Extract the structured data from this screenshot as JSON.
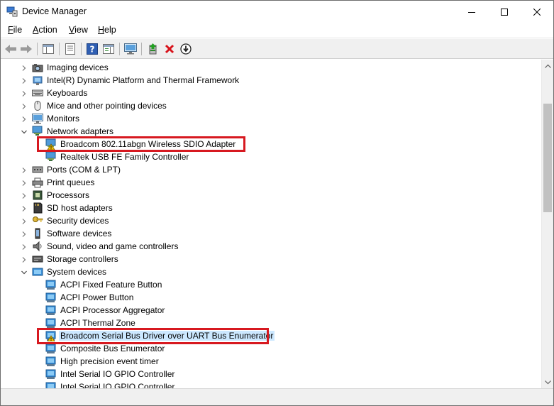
{
  "window": {
    "title": "Device Manager",
    "icon": "device-manager-icon"
  },
  "menu": {
    "file": "File",
    "action": "Action",
    "view": "View",
    "help": "Help"
  },
  "toolbar": {
    "buttons": [
      "back-icon",
      "forward-icon",
      "show-hide-console-tree-icon",
      "properties-icon",
      "help-icon",
      "action-pane-icon",
      "monitor-icon",
      "update-driver-icon",
      "uninstall-icon",
      "download-icon"
    ]
  },
  "tree": {
    "items": [
      {
        "label": "Imaging devices",
        "level": 0,
        "expanded": false,
        "icon": "camera-icon"
      },
      {
        "label": "Intel(R) Dynamic Platform and Thermal Framework",
        "level": 0,
        "expanded": false,
        "icon": "computer-chip-icon"
      },
      {
        "label": "Keyboards",
        "level": 0,
        "expanded": false,
        "icon": "keyboard-icon"
      },
      {
        "label": "Mice and other pointing devices",
        "level": 0,
        "expanded": false,
        "icon": "mouse-icon"
      },
      {
        "label": "Monitors",
        "level": 0,
        "expanded": false,
        "icon": "monitor-icon"
      },
      {
        "label": "Network adapters",
        "level": 0,
        "expanded": true,
        "icon": "network-adapter-icon"
      },
      {
        "label": "Broadcom 802.11abgn Wireless SDIO Adapter",
        "level": 1,
        "warning": true,
        "icon": "network-adapter-warning-icon"
      },
      {
        "label": "Realtek USB FE Family Controller",
        "level": 1,
        "icon": "network-adapter-icon"
      },
      {
        "label": "Ports (COM & LPT)",
        "level": 0,
        "expanded": false,
        "icon": "port-icon"
      },
      {
        "label": "Print queues",
        "level": 0,
        "expanded": false,
        "icon": "printer-icon"
      },
      {
        "label": "Processors",
        "level": 0,
        "expanded": false,
        "icon": "processor-icon"
      },
      {
        "label": "SD host adapters",
        "level": 0,
        "expanded": false,
        "icon": "sd-card-icon"
      },
      {
        "label": "Security devices",
        "level": 0,
        "expanded": false,
        "icon": "key-icon"
      },
      {
        "label": "Software devices",
        "level": 0,
        "expanded": false,
        "icon": "software-device-icon"
      },
      {
        "label": "Sound, video and game controllers",
        "level": 0,
        "expanded": false,
        "icon": "speaker-icon"
      },
      {
        "label": "Storage controllers",
        "level": 0,
        "expanded": false,
        "icon": "storage-controller-icon"
      },
      {
        "label": "System devices",
        "level": 0,
        "expanded": true,
        "icon": "system-folder-icon"
      },
      {
        "label": "ACPI Fixed Feature Button",
        "level": 1,
        "icon": "system-device-icon"
      },
      {
        "label": "ACPI Power Button",
        "level": 1,
        "icon": "system-device-icon"
      },
      {
        "label": "ACPI Processor Aggregator",
        "level": 1,
        "icon": "system-device-icon"
      },
      {
        "label": "ACPI Thermal Zone",
        "level": 1,
        "icon": "system-device-icon"
      },
      {
        "label": "Broadcom Serial Bus Driver over UART Bus Enumerator",
        "level": 1,
        "warning": true,
        "selected": true,
        "icon": "system-device-warning-icon"
      },
      {
        "label": "Composite Bus Enumerator",
        "level": 1,
        "icon": "system-device-icon"
      },
      {
        "label": "High precision event timer",
        "level": 1,
        "icon": "system-device-icon"
      },
      {
        "label": "Intel Serial IO GPIO Controller",
        "level": 1,
        "icon": "system-device-icon"
      },
      {
        "label": "Intel Serial IO GPIO Controller",
        "level": 1,
        "icon": "system-device-icon"
      }
    ]
  },
  "colors": {
    "highlight_box": "#d71920",
    "selection": "#cce8ff",
    "warning": "#f5c400"
  }
}
